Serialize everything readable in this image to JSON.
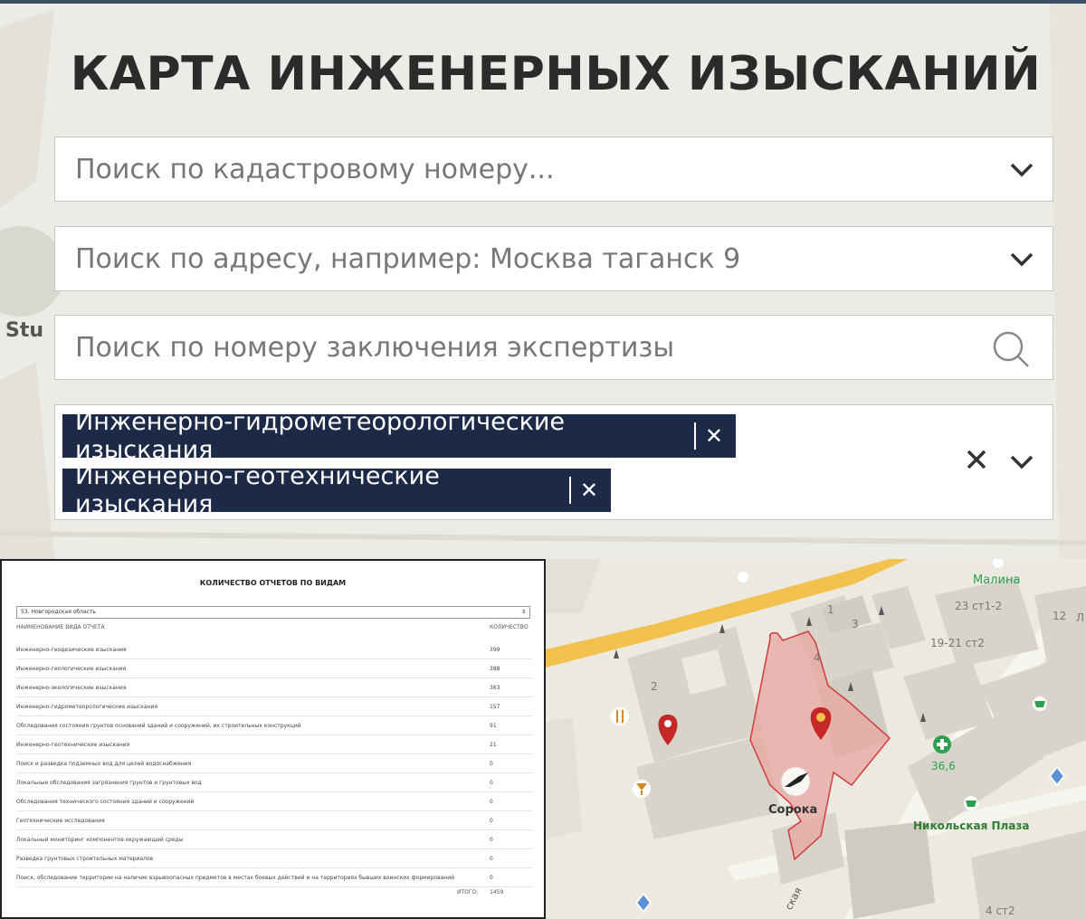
{
  "title": "КАРТА ИНЖЕНЕРНЫХ ИЗЫСКАНИЙ",
  "search": {
    "cadastral_placeholder": "Поиск по кадастровому номеру...",
    "address_placeholder": "Поиск по адресу, например: Москва таганск 9",
    "expertise_placeholder": "Поиск по номеру заключения экспертизы"
  },
  "filter": {
    "tags": [
      {
        "label": "Инженерно-гидрометеорологические изыскания",
        "remove": "✕"
      },
      {
        "label": "Инженерно-геотехнические изыскания",
        "remove": "✕"
      }
    ]
  },
  "report": {
    "title": "КОЛИЧЕСТВО ОТЧЕТОВ ПО ВИДАМ",
    "region": "53. Новгородская область",
    "col_name": "НАИМЕНОВАНИЕ ВИДА ОТЧЕТА",
    "col_count": "КОЛИЧЕСТВО",
    "rows": [
      {
        "name": "Инженерно-геодезические изыскания",
        "count": "399"
      },
      {
        "name": "Инженерно-геологические изыскания",
        "count": "388"
      },
      {
        "name": "Инженерно-экологические изыскания",
        "count": "363"
      },
      {
        "name": "Инженерно-гидрометеорологические изыскания",
        "count": "157"
      },
      {
        "name": "Обследования состояния грунтов оснований зданий и сооружений, их строительных конструкций",
        "count": "91"
      },
      {
        "name": "Инженерно-геотехнические изыскания",
        "count": "21"
      },
      {
        "name": "Поиск и разведка подземных вод для целей водоснабжения",
        "count": "0"
      },
      {
        "name": "Локальные обследования загрязнения грунтов и грунтовых вод",
        "count": "0"
      },
      {
        "name": "Обследования технического состояния зданий и сооружений",
        "count": "0"
      },
      {
        "name": "Геотехнические исследования",
        "count": "0"
      },
      {
        "name": "Локальный мониторинг компонентов окружающей среды",
        "count": "0"
      },
      {
        "name": "Разведка грунтовых строительных материалов",
        "count": "0"
      },
      {
        "name": "Поиск, обследование территории на наличие взрывоопасных предметов в местах боевых действий и на территориях бывших воинских формирований",
        "count": "0"
      }
    ],
    "total_label": "ИТОГО:",
    "total": "1459"
  },
  "map": {
    "labels": {
      "malina": "Малина",
      "soroka": "Сорока",
      "pharmacy": "36,6",
      "nikolskaya": "Никольская Плаза",
      "b23": "23 ст1-2",
      "b1921": "19-21 ст2",
      "n12": "12",
      "n1": "1",
      "n3": "3",
      "n4": "4",
      "n2": "2",
      "b4st2": "4 ст2",
      "edge_l": "Л",
      "street": "ская"
    }
  },
  "colors": {
    "tag_bg": "#1c2a48",
    "parcel_fill": "#e8a5a0",
    "parcel_stroke": "#d23c3c",
    "road_yellow": "#f2c14e",
    "pin_red": "#c62828"
  }
}
